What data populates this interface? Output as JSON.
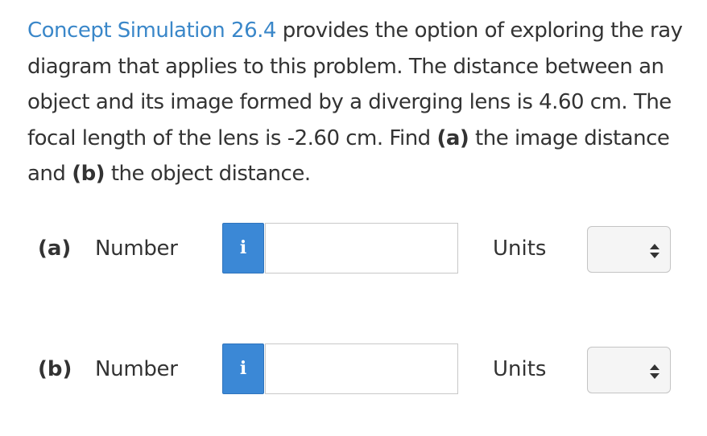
{
  "problem": {
    "link_text": "Concept Simulation 26.4",
    "text_1": " provides the option of exploring the ray diagram that applies to this problem. The distance between an object and its image formed by a diverging lens is 4.60 cm. The focal length of the lens is -2.60 cm. Find ",
    "part_a_marker": "(a)",
    "text_2": " the image distance and ",
    "part_b_marker": "(b)",
    "text_3": " the object distance."
  },
  "answers": [
    {
      "part": "(a)",
      "number_label": "Number",
      "info_icon": "i",
      "number_value": "",
      "units_label": "Units",
      "units_value": ""
    },
    {
      "part": "(b)",
      "number_label": "Number",
      "info_icon": "i",
      "number_value": "",
      "units_label": "Units",
      "units_value": ""
    }
  ],
  "colors": {
    "link": "#3a87c9",
    "info_button": "#3b88d6",
    "text": "#333333"
  }
}
